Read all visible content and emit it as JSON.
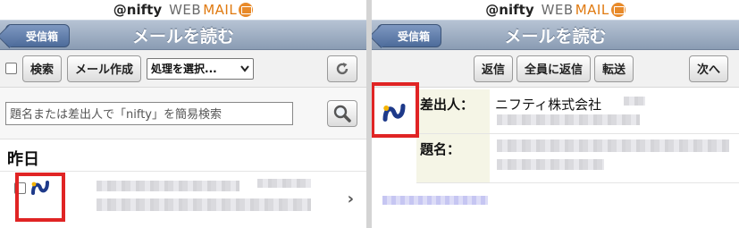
{
  "brand": {
    "nifty": "@nifty",
    "web": "WEB",
    "mail": "MAIL",
    "mail_icon": "mail-icon"
  },
  "colors": {
    "highlight": "#e02424",
    "titlebar": "#8a9cb4",
    "brand_mail": "#e07a10"
  },
  "left_pane": {
    "back_label": "受信箱",
    "title": "メールを読む",
    "toolbar": {
      "search_label": "検索",
      "compose_label": "メール作成",
      "action_select": "処理を選択..."
    },
    "search": {
      "placeholder": "題名または差出人で「nifty」を簡易検索"
    },
    "section_label": "昨日"
  },
  "right_pane": {
    "back_label": "受信箱",
    "title": "メールを読む",
    "toolbar": {
      "reply_label": "返信",
      "reply_all_label": "全員に返信",
      "forward_label": "転送",
      "next_label": "次へ"
    },
    "headers": {
      "from_label": "差出人：",
      "from_value": "ニフティ株式会社",
      "subject_label": "題名："
    }
  }
}
